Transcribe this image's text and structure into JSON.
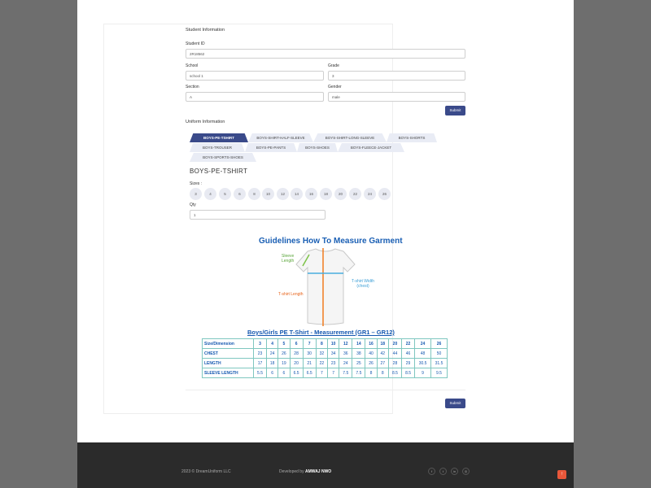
{
  "student": {
    "section_title": "Student Information",
    "id_label": "Student ID",
    "id_value": "2R18562",
    "school_label": "School",
    "school_value": "school 1",
    "grade_label": "Grade",
    "grade_value": "3",
    "section_label": "Section",
    "section_value": "A",
    "gender_label": "Gender",
    "gender_value": "male",
    "submit_label": "Submit"
  },
  "uniform": {
    "section_title": "Uniform Information",
    "tabs": [
      "BOYS-PE-TSHIRT",
      "BOYS-SHIRT-HALF-SLEEVE",
      "BOYS-SHIRT-LONG-SLEEVE",
      "BOYS-SHORTS",
      "BOYS-TROUSER",
      "BOYS-PE-PANTS",
      "BOYS-SHOES",
      "BOYS-FLEECE-JACKET",
      "BOYS-SPORTS-SHOES"
    ],
    "active_tab": "BOYS-PE-TSHIRT",
    "product_title": "BOYS-PE-TSHIRT",
    "sizes_label": "Sizes :",
    "sizes": [
      "3",
      "4",
      "5",
      "6",
      "8",
      "10",
      "12",
      "14",
      "16",
      "18",
      "20",
      "22",
      "24",
      "26"
    ],
    "qty_label": "Qty",
    "qty_value": "1",
    "submit_label": "Submit"
  },
  "guide": {
    "title": "Guidelines How To Measure Garment",
    "sleeve_label_1": "Sleeve",
    "sleeve_label_2": "Length",
    "width_label_1": "T-shirt Width",
    "width_label_2": "(chest)",
    "length_label": "T-shirt Length",
    "table_title": "Boys/Girls PE T-Shirt - Measurement  (GR1 – GR12)",
    "header": [
      "Size/Dimension",
      "3",
      "4",
      "5",
      "6",
      "7",
      "8",
      "10",
      "12",
      "14",
      "16",
      "18",
      "20",
      "22",
      "24",
      "26"
    ],
    "rows": [
      [
        "CHEST",
        "23",
        "24",
        "26",
        "28",
        "30",
        "32",
        "34",
        "36",
        "38",
        "40",
        "42",
        "44",
        "46",
        "48",
        "50"
      ],
      [
        "LENGTH",
        "17",
        "18",
        "19",
        "20",
        "21",
        "22",
        "23",
        "24",
        "25",
        "26",
        "27",
        "28",
        "29",
        "30.5",
        "31.5"
      ],
      [
        "SLEEVE LENGTH",
        "5.5",
        "6",
        "6",
        "6.5",
        "6.5",
        "7",
        "7",
        "7.5",
        "7.5",
        "8",
        "8",
        "8.5",
        "8.5",
        "9",
        "9.5"
      ]
    ]
  },
  "footer": {
    "copyright": "2023 © DreamUniform LLC",
    "developed_prefix": "Developed by",
    "developer": "AMWAJ NWO",
    "social_icons": [
      "facebook-icon",
      "twitter-icon",
      "linkedin-icon",
      "instagram-icon"
    ]
  },
  "colors": {
    "accent": "#3a4a8a",
    "footer_bg": "#2b2b2b",
    "back_to_top": "#e8573a",
    "guide_blue": "#1a5fb4"
  }
}
